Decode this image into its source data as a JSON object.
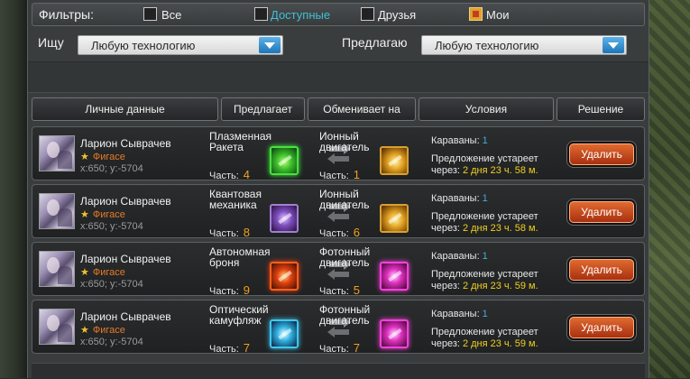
{
  "filters": {
    "label": "Фильтры:",
    "options": [
      {
        "label": "Все",
        "checked": false,
        "color": "#f0f0f0"
      },
      {
        "label": "Доступные",
        "checked": false,
        "color": "#3fc0d8"
      },
      {
        "label": "Друзья",
        "checked": false,
        "color": "#f0f0f0"
      },
      {
        "label": "Мои",
        "checked": true,
        "color": "#f0f0f0"
      }
    ]
  },
  "search": {
    "seek_label": "Ищу",
    "seek_value": "Любую технологию",
    "offer_label": "Предлагаю",
    "offer_value": "Любую технологию"
  },
  "table": {
    "headers": [
      "Личные данные",
      "Предлагает",
      "Обменивает на",
      "Условия",
      "Решение"
    ],
    "rows": [
      {
        "name": "Ларион Сыврачев",
        "clan": "Фигасе",
        "coords": "x:650; y:-5704",
        "offer_name": "Плазменная Ракета",
        "offer_part_label": "Часть:",
        "offer_part": "4",
        "offer_icon": "green",
        "want_name": "Ионный двигатель",
        "want_part_label": "Часть:",
        "want_part": "1",
        "want_icon": "gold",
        "caravans_label": "Караваны:",
        "caravans": "1",
        "expire_label": "Предложение устареет",
        "expire_prefix": "через:",
        "expire_time": "2 дня 23 ч. 58 м.",
        "delete_label": "Удалить"
      },
      {
        "name": "Ларион Сыврачев",
        "clan": "Фигасе",
        "coords": "x:650; y:-5704",
        "offer_name": "Квантовая механика",
        "offer_part_label": "Часть:",
        "offer_part": "8",
        "offer_icon": "violet",
        "want_name": "Ионный двигатель",
        "want_part_label": "Часть:",
        "want_part": "6",
        "want_icon": "gold",
        "caravans_label": "Караваны:",
        "caravans": "1",
        "expire_label": "Предложение устареет",
        "expire_prefix": "через:",
        "expire_time": "2 дня 23 ч. 58 м.",
        "delete_label": "Удалить"
      },
      {
        "name": "Ларион Сыврачев",
        "clan": "Фигасе",
        "coords": "x:650; y:-5704",
        "offer_name": "Автономная броня",
        "offer_part_label": "Часть:",
        "offer_part": "9",
        "offer_icon": "red",
        "want_name": "Фотонный двигатель",
        "want_part_label": "Часть:",
        "want_part": "5",
        "want_icon": "pink",
        "caravans_label": "Караваны:",
        "caravans": "1",
        "expire_label": "Предложение устареет",
        "expire_prefix": "через:",
        "expire_time": "2 дня 23 ч. 59 м.",
        "delete_label": "Удалить"
      },
      {
        "name": "Ларион Сыврачев",
        "clan": "Фигасе",
        "coords": "x:650; y:-5704",
        "offer_name": "Оптический камуфляж",
        "offer_part_label": "Часть:",
        "offer_part": "7",
        "offer_icon": "cyan",
        "want_name": "Фотонный двигатель",
        "want_part_label": "Часть:",
        "want_part": "7",
        "want_icon": "pink",
        "caravans_label": "Караваны:",
        "caravans": "1",
        "expire_label": "Предложение устареет",
        "expire_prefix": "через:",
        "expire_time": "2 дня 23 ч. 59 м.",
        "delete_label": "Удалить"
      }
    ]
  }
}
